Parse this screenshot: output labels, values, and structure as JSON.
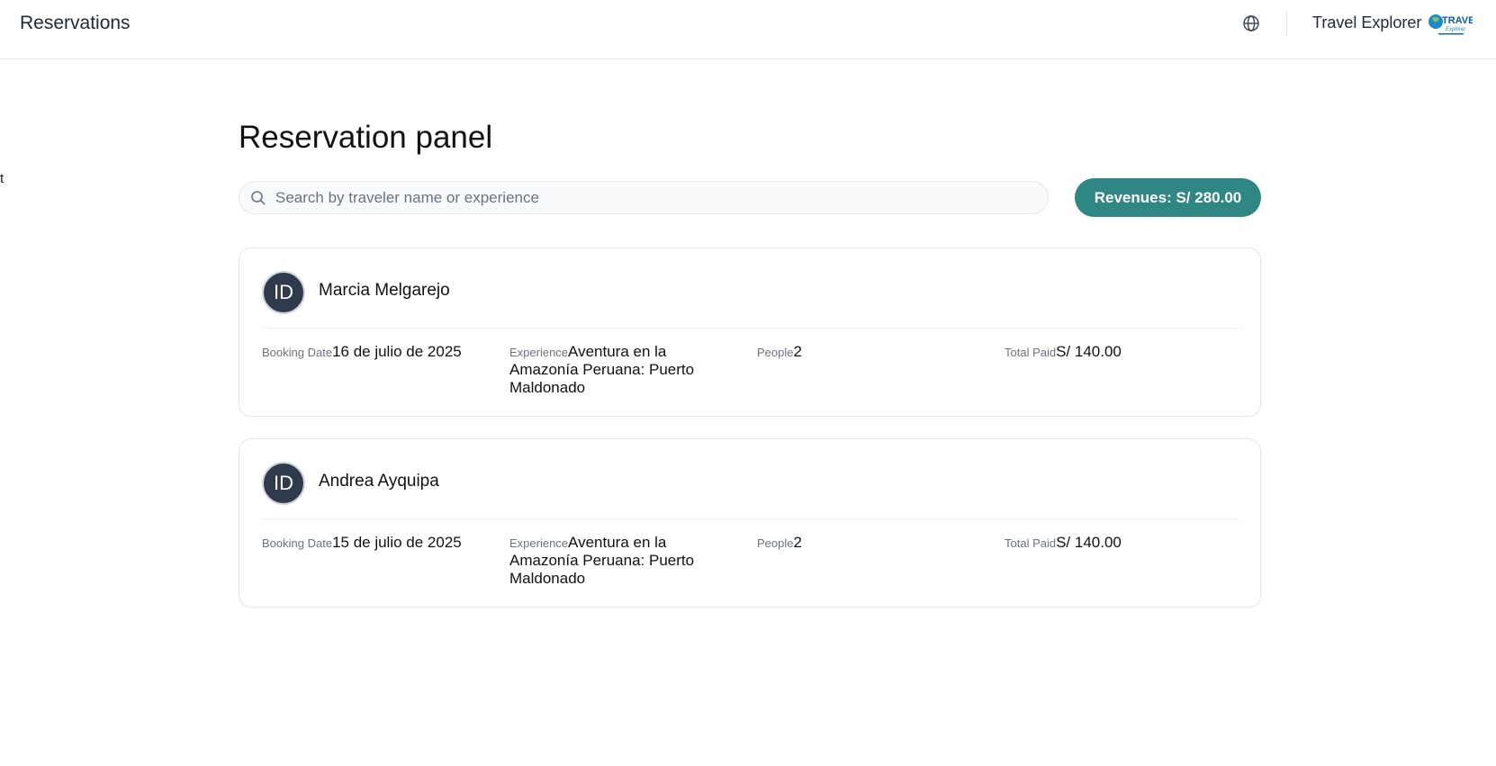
{
  "header": {
    "title": "Reservations",
    "brand_name": "Travel Explorer",
    "icons": [
      "globe-icon",
      "travel-explorer-logo"
    ]
  },
  "stray_text": "t",
  "page": {
    "title": "Reservation panel",
    "search": {
      "placeholder": "Search by traveler name or experience",
      "value": ""
    },
    "revenue_label": "Revenues: S/ 280.00"
  },
  "reservations": [
    {
      "avatar": "ID",
      "name": "Marcia Melgarejo",
      "booking_label": "Booking Date",
      "booking_date": "16 de julio de 2025",
      "experience_label": "Experience",
      "experience": "Aventura en la Amazonía Peruana: Puerto Maldonado",
      "people_label": "People",
      "people": "2",
      "total_label": "Total Paid",
      "total": "S/ 140.00"
    },
    {
      "avatar": "ID",
      "name": "Andrea Ayquipa",
      "booking_label": "Booking Date",
      "booking_date": "15 de julio de 2025",
      "experience_label": "Experience",
      "experience": "Aventura en la Amazonía Peruana: Puerto Maldonado",
      "people_label": "People",
      "people": "2",
      "total_label": "Total Paid",
      "total": "S/ 140.00"
    }
  ],
  "colors": {
    "accent": "#2f8783",
    "avatar_bg": "#2f3b4c",
    "muted": "#6b7280"
  }
}
